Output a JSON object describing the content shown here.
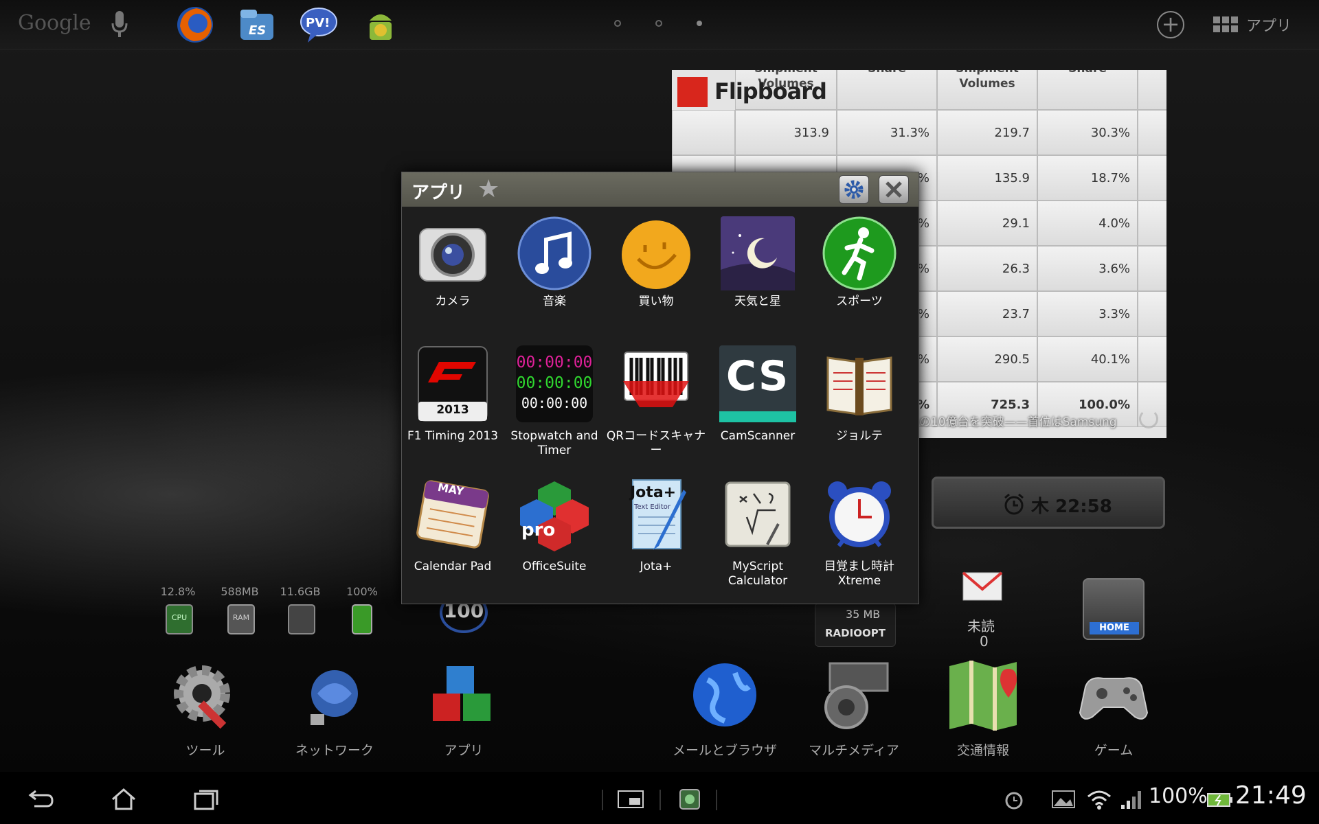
{
  "top_bar": {
    "search_logo": "Google",
    "apps_label": "アプリ",
    "dock_icons": [
      "firefox-icon",
      "es-file-explorer-icon",
      "pv-counter-icon",
      "android-robot-icon"
    ],
    "page_indicator": {
      "pages": 3,
      "current": 3
    }
  },
  "flipboard": {
    "name": "Flipboard",
    "table": {
      "headers": [
        "Shipment Volumes",
        "Share",
        "Shipment Volumes",
        "Share"
      ],
      "rows": [
        [
          "",
          "313.9",
          "31.3%",
          "219.7",
          "30.3%"
        ],
        [
          "",
          "",
          "%",
          "135.9",
          "18.7%"
        ],
        [
          "",
          "",
          "%",
          "29.1",
          "4.0%"
        ],
        [
          "",
          "",
          "%",
          "26.3",
          "3.6%"
        ],
        [
          "",
          "",
          "%",
          "23.7",
          "3.3%"
        ],
        [
          "",
          "",
          "%",
          "290.5",
          "40.1%"
        ],
        [
          "",
          "",
          "%",
          "725.3",
          "100.0%"
        ]
      ]
    },
    "caption": "の10億台を突破——首位はSamsung"
  },
  "alarm_widget": {
    "text": "木 22:58"
  },
  "resource_monitor": [
    {
      "value": "12.8%",
      "label": "CPU"
    },
    {
      "value": "588MB",
      "label": "RAM"
    },
    {
      "value": "11.6GB",
      "label": ""
    },
    {
      "value": "100%",
      "label": ""
    }
  ],
  "speed_gauge": {
    "value": "100"
  },
  "radio_widget": {
    "size": "35 MB",
    "name": "RADIOOPT"
  },
  "unread_widget": {
    "label": "未読",
    "count": "0"
  },
  "home_widget": {
    "label": "HOME"
  },
  "home_folders": [
    {
      "label": "ツール",
      "icon": "tools-gear-icon"
    },
    {
      "label": "ネットワーク",
      "icon": "network-globe-icon"
    },
    {
      "label": "アプリ",
      "icon": "apps-cubes-icon"
    },
    {
      "label": "メールとブラウザ",
      "icon": "globe-icon"
    },
    {
      "label": "マルチメディア",
      "icon": "speaker-film-icon"
    },
    {
      "label": "交通情報",
      "icon": "maps-icon"
    },
    {
      "label": "ゲーム",
      "icon": "gamepad-icon"
    }
  ],
  "dialog": {
    "title": "アプリ",
    "apps": [
      {
        "label": "カメラ",
        "icon": "camera-icon"
      },
      {
        "label": "音楽",
        "icon": "music-note-icon"
      },
      {
        "label": "買い物",
        "icon": "smiley-icon"
      },
      {
        "label": "天気と星",
        "icon": "moon-night-icon"
      },
      {
        "label": "スポーツ",
        "icon": "runner-icon"
      },
      {
        "label": "F1 Timing 2013",
        "icon": "f1-logo-icon",
        "badge": "2013"
      },
      {
        "label": "Stopwatch and Timer",
        "icon": "stopwatch-digits-icon",
        "lines": [
          "00:00:00",
          "00:00:00",
          "00:00:00"
        ]
      },
      {
        "label": "QRコードスキャナー",
        "icon": "barcode-icon"
      },
      {
        "label": "CamScanner",
        "icon": "cs-logo-icon",
        "badge": "CS"
      },
      {
        "label": "ジョルテ",
        "icon": "planner-book-icon"
      },
      {
        "label": "Calendar Pad",
        "icon": "calendar-icon",
        "badge": "MAY"
      },
      {
        "label": "OfficeSuite",
        "icon": "officesuite-cubes-icon",
        "badge": "pro"
      },
      {
        "label": "Jota+",
        "icon": "notepad-pen-icon",
        "badge": "Jota+",
        "sub": "Text Editor"
      },
      {
        "label": "MyScript Calculator",
        "icon": "math-board-icon"
      },
      {
        "label": "目覚まし時計 Xtreme",
        "icon": "alarm-clock-icon"
      }
    ]
  },
  "status_bar": {
    "battery": "100%",
    "time": "21:49"
  }
}
